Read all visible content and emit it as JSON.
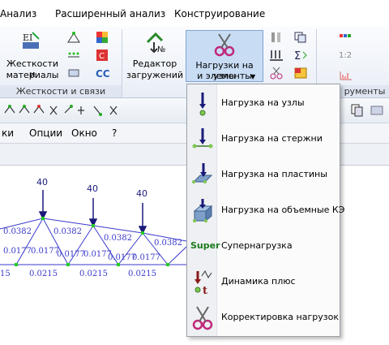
{
  "ribbon_tabs": [
    "Анализ",
    "Расширенный анализ",
    "Конструирование"
  ],
  "ribbon": {
    "stiffness_button": {
      "line1": "Жесткости и",
      "line2": "материалы"
    },
    "stiffness_group": "Жесткости и связи",
    "load_editor_button": {
      "line1": "Редактор",
      "line2": "загружений"
    },
    "loads_button": {
      "line1": "Нагрузки на узлы",
      "line2": "и элементы"
    },
    "instruments_group": "рументы",
    "cc_label": "CC",
    "zoom_label": "1:2"
  },
  "menu": [
    "ки",
    "Опции",
    "Окно",
    "?"
  ],
  "dropdown": [
    {
      "label": "Нагрузка на узлы",
      "icon": "node-load-icon"
    },
    {
      "label": "Нагрузка на стержни",
      "icon": "bar-load-icon"
    },
    {
      "label": "Нагрузка на пластины",
      "icon": "plate-load-icon"
    },
    {
      "label": "Нагрузка на объемные КЭ",
      "icon": "volume-load-icon"
    },
    {
      "label": "Супернагрузка",
      "icon": "super-load-icon"
    },
    {
      "label": "Динамика плюс",
      "icon": "dynamics-icon"
    },
    {
      "label": "Корректировка нагрузок",
      "icon": "load-correction-icon"
    }
  ],
  "dropdown_super_label": "Super",
  "truss": {
    "load_labels": [
      "40",
      "40",
      "40"
    ],
    "top_chord_values": [
      "0.0382",
      "0.0382",
      "0.0382",
      "0.0382"
    ],
    "diagonal_values": [
      "0.0177",
      "0.0177",
      "0.0177",
      "0.0177",
      "0.0177",
      "0.0177",
      "0.0177",
      "0.0177"
    ],
    "bottom_chord_values": [
      "15",
      "0.0215",
      "0.0215",
      "0.0215"
    ]
  },
  "colors": {
    "accent": "#c8dcf4",
    "truss_line": "#3333cc",
    "load_arrow": "#1a1a7a",
    "node": "#22cc22",
    "super_text": "#1a7a1a"
  }
}
